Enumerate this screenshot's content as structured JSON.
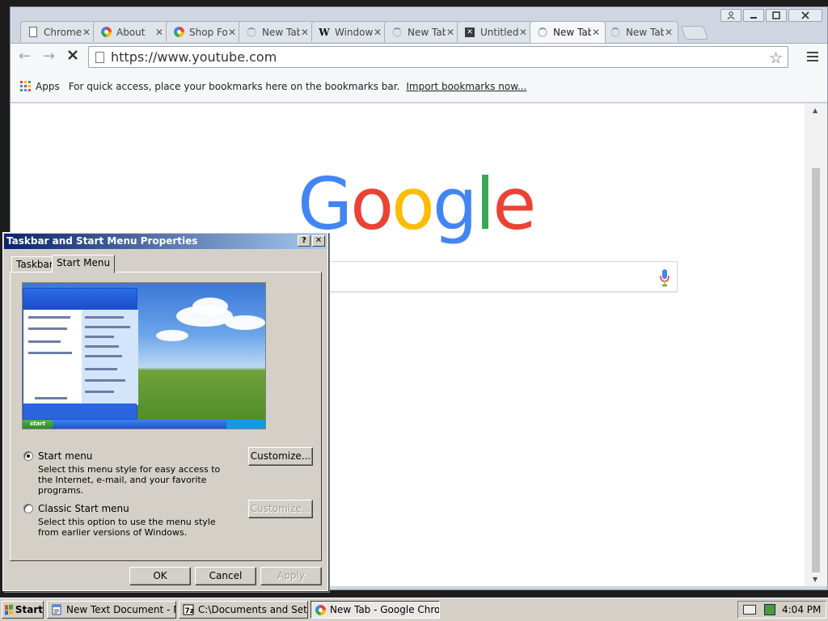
{
  "chrome": {
    "tabs": [
      {
        "title": "Chrome",
        "icon": "document-icon"
      },
      {
        "title": "About",
        "icon": "google-chrome-icon"
      },
      {
        "title": "Shop Fo",
        "icon": "google-chrome-icon"
      },
      {
        "title": "New Tab",
        "icon": "loading-spinner-icon"
      },
      {
        "title": "Window",
        "icon": "wikipedia-icon"
      },
      {
        "title": "New Tab",
        "icon": "loading-spinner-icon"
      },
      {
        "title": "Untitled",
        "icon": "x-app-icon"
      },
      {
        "title": "New Tab",
        "icon": "loading-spinner-icon",
        "active": true
      },
      {
        "title": "New Tab",
        "icon": "loading-spinner-icon"
      }
    ],
    "tab_close_glyph": "✕",
    "url": "https://www.youtube.com",
    "bookmarks": {
      "apps_label": "Apps",
      "hint": "For quick access, place your bookmarks here on the bookmarks bar.",
      "import_link": "Import bookmarks now..."
    },
    "page": {
      "logo_letters": [
        "G",
        "o",
        "o",
        "g",
        "l",
        "e"
      ],
      "logo_colors": [
        "#4285F4",
        "#EA4335",
        "#FBBC05",
        "#4285F4",
        "#34A853",
        "#EA4335"
      ]
    }
  },
  "dialog": {
    "title": "Taskbar and Start Menu Properties",
    "help_glyph": "?",
    "close_glyph": "✕",
    "tabs": [
      "Taskbar",
      "Start Menu"
    ],
    "preview_start_label": "start",
    "options": [
      {
        "label": "Start menu",
        "checked": true,
        "description": "Select this menu style for easy access to the Internet, e-mail, and your favorite programs.",
        "button": "Customize...",
        "button_enabled": true
      },
      {
        "label": "Classic Start menu",
        "checked": false,
        "description": "Select this option to use the menu style from earlier versions of Windows.",
        "button": "Customize...",
        "button_enabled": false
      }
    ],
    "buttons": {
      "ok": "OK",
      "cancel": "Cancel",
      "apply": "Apply"
    }
  },
  "taskbar": {
    "start_label": "Start",
    "tasks": [
      {
        "label": "New Text Document - No..."
      },
      {
        "label": "C:\\Documents and Settin..."
      },
      {
        "label": "New Tab - Google Chrome",
        "active": true
      }
    ],
    "clock": "4:04 PM"
  },
  "colors": {
    "xp_title_start": "#0a246a",
    "xp_face": "#d4d0c8",
    "chrome_frame": "#cfd6e1"
  }
}
